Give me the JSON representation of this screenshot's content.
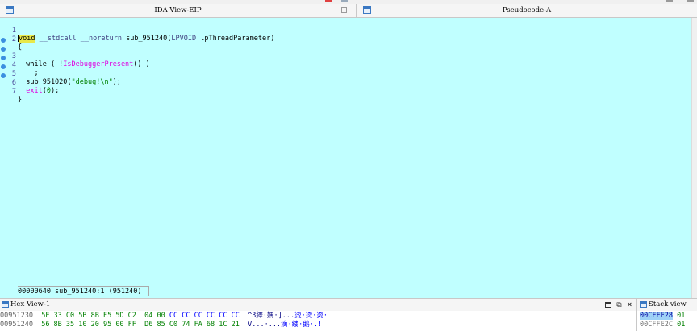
{
  "tabs": {
    "ida_view": {
      "title": "IDA View-EIP",
      "icon": "window-icon"
    },
    "pseudocode": {
      "title": "Pseudocode-A",
      "icon": "window-icon"
    }
  },
  "code": {
    "lines": [
      {
        "num": "1",
        "breakpoint": false,
        "text": "void __stdcall __noreturn sub_951240(LPVOID lpThreadParameter)"
      },
      {
        "num": "2",
        "breakpoint": false,
        "text": "{"
      },
      {
        "num": "3",
        "breakpoint": true,
        "text": "  while ( !IsDebuggerPresent() )"
      },
      {
        "num": "4",
        "breakpoint": true,
        "text": "    ;"
      },
      {
        "num": "5",
        "breakpoint": true,
        "text": "  sub_951020(\"debug!\\n\");"
      },
      {
        "num": "6",
        "breakpoint": true,
        "text": "  exit(0);"
      },
      {
        "num": "7",
        "breakpoint": true,
        "text": "}"
      }
    ],
    "status": "00000640 sub_951240:1 (951240)"
  },
  "hex_view": {
    "title": "Hex View-1",
    "rows": [
      {
        "addr": "00951230",
        "bytes_a": "5E 33 C0 5B 8B E5 5D C2",
        "bytes_b": "04 00",
        "bytes_c": "CC CC CC CC CC CC",
        "ascii_a": "^3繹·媽·]...",
        "ascii_b": "烫·烫·烫·"
      },
      {
        "addr": "00951240",
        "bytes_a": "56 8B 35 10 20 95 00 FF",
        "bytes_b": "D6 85 C0 74 FA 68 1C 21",
        "bytes_c": "",
        "ascii_a": "V...·...",
        "ascii_b": "滴·缕·鹅·.!"
      }
    ]
  },
  "stack_view": {
    "title": "Stack view",
    "rows": [
      {
        "addr": "00CFFE28",
        "val": "01",
        "selected": true
      },
      {
        "addr": "00CFFE2C",
        "val": "01",
        "selected": false
      }
    ]
  },
  "colors": {
    "code_bg": "#c0ffff",
    "keyword": "#0000ff",
    "function": "#e000e0",
    "string": "#008000",
    "breakpoint": "#3b8fe0"
  }
}
